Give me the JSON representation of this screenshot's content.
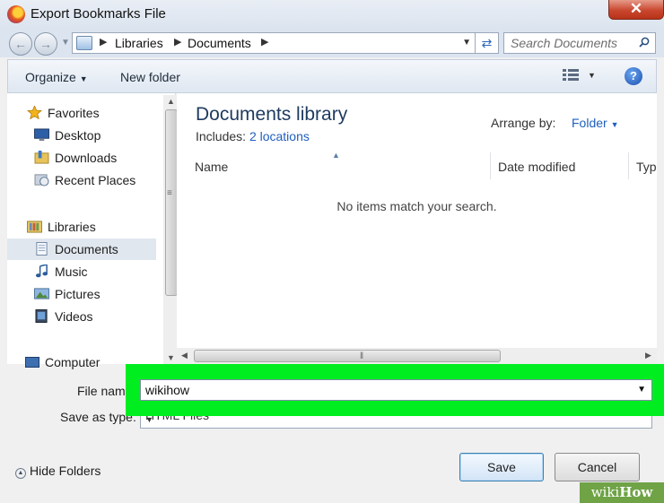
{
  "window": {
    "title": "Export Bookmarks File",
    "close_symbol": "✕"
  },
  "address": {
    "crumbs": [
      "Libraries",
      "Documents"
    ],
    "search_placeholder": "Search Documents"
  },
  "toolbar": {
    "organize": "Organize",
    "new_folder": "New folder",
    "help": "?"
  },
  "sidebar": {
    "items": [
      {
        "label": "Favorites",
        "icon": "star-icon"
      },
      {
        "label": "Desktop",
        "icon": "desktop-icon"
      },
      {
        "label": "Downloads",
        "icon": "downloads-folder-icon"
      },
      {
        "label": "Recent Places",
        "icon": "recent-places-icon"
      },
      {
        "label": "Libraries",
        "icon": "libraries-icon"
      },
      {
        "label": "Documents",
        "icon": "documents-icon",
        "selected": true
      },
      {
        "label": "Music",
        "icon": "music-icon"
      },
      {
        "label": "Pictures",
        "icon": "pictures-icon"
      },
      {
        "label": "Videos",
        "icon": "videos-icon"
      }
    ],
    "computer": "Computer"
  },
  "library": {
    "title": "Documents library",
    "includes_label": "Includes:",
    "locations_link": "2 locations",
    "arrange_label": "Arrange by:",
    "arrange_value": "Folder"
  },
  "columns": [
    "Name",
    "Date modified",
    "Typ"
  ],
  "empty_message": "No items match your search.",
  "form": {
    "filename_label": "File nam",
    "filename_value": "wikihow",
    "savetype_label": "Save as type:",
    "savetype_value": "HTML Files"
  },
  "footer": {
    "hide_folders": "Hide Folders",
    "save": "Save",
    "cancel": "Cancel"
  },
  "watermark": {
    "part1": "wiki",
    "part2": "How"
  },
  "colors": {
    "highlight": "#00ee20",
    "link": "#1f5fbf",
    "close": "#c9472f"
  }
}
